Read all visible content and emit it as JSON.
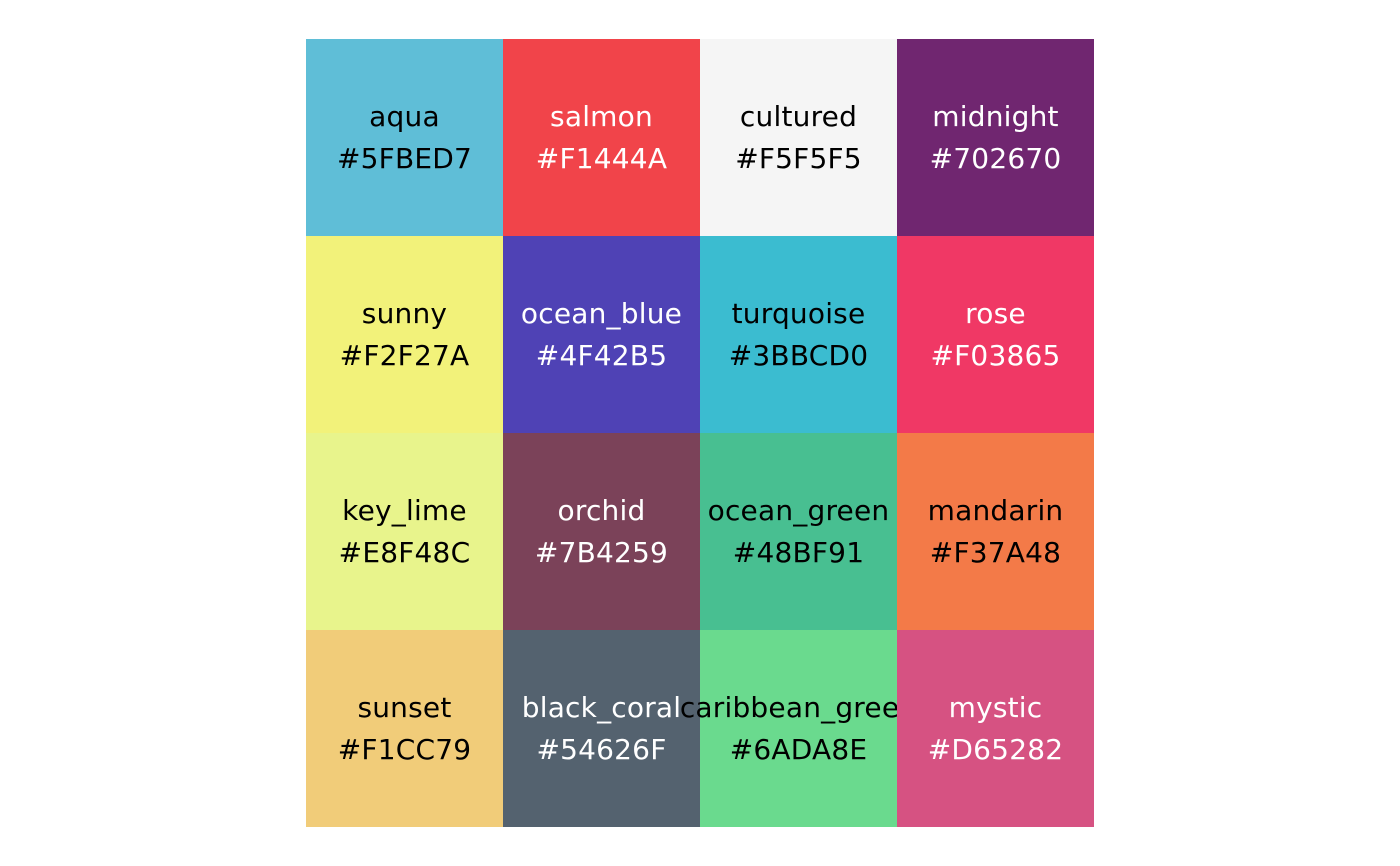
{
  "swatches": [
    {
      "name": "aqua",
      "hex": "#5FBED7",
      "color": "#5FBED7",
      "text_color": "#000000"
    },
    {
      "name": "salmon",
      "hex": "#F1444A",
      "color": "#F1444A",
      "text_color": "#FFFFFF"
    },
    {
      "name": "cultured",
      "hex": "#F5F5F5",
      "color": "#F5F5F5",
      "text_color": "#000000"
    },
    {
      "name": "midnight",
      "hex": "#702670",
      "color": "#702670",
      "text_color": "#FFFFFF"
    },
    {
      "name": "sunny",
      "hex": "#F2F27A",
      "color": "#F2F27A",
      "text_color": "#000000"
    },
    {
      "name": "ocean_blue",
      "hex": "#4F42B5",
      "color": "#4F42B5",
      "text_color": "#FFFFFF"
    },
    {
      "name": "turquoise",
      "hex": "#3BBCD0",
      "color": "#3BBCD0",
      "text_color": "#000000"
    },
    {
      "name": "rose",
      "hex": "#F03865",
      "color": "#F03865",
      "text_color": "#FFFFFF"
    },
    {
      "name": "key_lime",
      "hex": "#E8F48C",
      "color": "#E8F48C",
      "text_color": "#000000"
    },
    {
      "name": "orchid",
      "hex": "#7B4259",
      "color": "#7B4259",
      "text_color": "#FFFFFF"
    },
    {
      "name": "ocean_green",
      "hex": "#48BF91",
      "color": "#48BF91",
      "text_color": "#000000"
    },
    {
      "name": "mandarin",
      "hex": "#F37A48",
      "color": "#F37A48",
      "text_color": "#000000"
    },
    {
      "name": "sunset",
      "hex": "#F1CC79",
      "color": "#F1CC79",
      "text_color": "#000000"
    },
    {
      "name": "black_coral",
      "hex": "#54626F",
      "color": "#54626F",
      "text_color": "#FFFFFF"
    },
    {
      "name": "caribbean_green",
      "hex": "#6ADA8E",
      "color": "#6ADA8E",
      "text_color": "#000000"
    },
    {
      "name": "mystic",
      "hex": "#D65282",
      "color": "#D65282",
      "text_color": "#FFFFFF"
    }
  ]
}
